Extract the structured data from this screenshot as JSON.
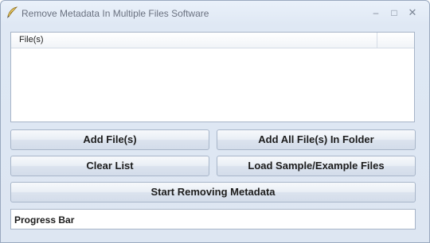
{
  "window": {
    "title": "Remove Metadata In Multiple Files Software",
    "minimize_glyph": "–",
    "maximize_glyph": "□",
    "close_glyph": "✕",
    "icon": "quill-pen-icon"
  },
  "file_list": {
    "column_header": "File(s)",
    "rows": []
  },
  "buttons": {
    "add_files": "Add File(s)",
    "add_folder": "Add All File(s) In Folder",
    "clear_list": "Clear List",
    "load_sample": "Load Sample/Example Files",
    "start": "Start Removing Metadata"
  },
  "progress": {
    "label": "Progress Bar",
    "value": 0
  }
}
